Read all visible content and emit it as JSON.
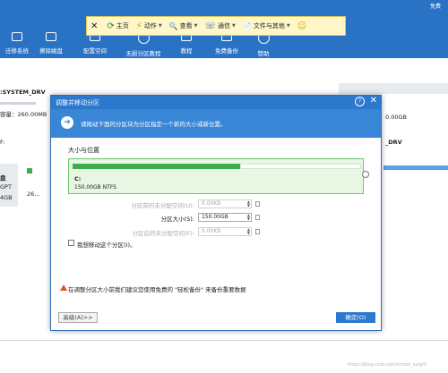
{
  "app": {
    "title": "免费"
  },
  "toolbar": {
    "items": [
      {
        "icon": "close-icon",
        "glyph": "✕",
        "label": ""
      },
      {
        "icon": "home-icon",
        "glyph": "⟳",
        "label": "主页"
      },
      {
        "icon": "lightning-icon",
        "glyph": "⚡",
        "label": "动作"
      },
      {
        "icon": "magnifier-icon",
        "glyph": "🔍",
        "label": "查看"
      },
      {
        "icon": "phone-icon",
        "glyph": "☏",
        "label": "通信"
      },
      {
        "icon": "file-icon",
        "glyph": "📄",
        "label": "文件与其他"
      },
      {
        "icon": "smiley-icon",
        "glyph": "☺",
        "label": ""
      }
    ]
  },
  "nav": {
    "items": [
      {
        "label": "迁移系统"
      },
      {
        "label": "擦除磁盘"
      },
      {
        "label": "配置空间"
      },
      {
        "label": "无损分区教程"
      },
      {
        "label": "教程"
      },
      {
        "label": "免费备份"
      },
      {
        "label": "赞助"
      }
    ]
  },
  "disk": {
    "name": ":SYSTEM_DRV",
    "capacity": "容量：260.00MB",
    "colon_label": "F:",
    "type_prefix": "盘",
    "gpt": "GPT",
    "size": "4GB",
    "small_num": "26...",
    "right_label": "_DRV",
    "right_size": "0.00GB"
  },
  "dialog": {
    "title": "调整并移动分区",
    "help": "?",
    "close": "✕",
    "banner_text": "请拖动下面的分区块为分区指定一个新的大小或新位置。",
    "banner_glyph": "➔",
    "size_position_label": "大小与位置",
    "partition_letter": "C:",
    "partition_info": "150.00GB NTFS",
    "partition_used_fraction": 0.58,
    "fields": [
      {
        "label": "分区前的未分配空间(U):",
        "value": "0.00KB",
        "enabled": false
      },
      {
        "label": "分区大小(S):",
        "value": "150.00GB",
        "enabled": true
      },
      {
        "label": "分区后的未分配空间(F):",
        "value": "0.00KB",
        "enabled": false
      }
    ],
    "checkbox_label": "我想移动这个分区(I)。",
    "checkbox_checked": false,
    "warning_text": "在调整分区大小前我们建议您使用免费的 \"轻松备份\" 来备份重要数据",
    "back_button": "高级(A)>>",
    "ok_button": "确定(O)"
  },
  "watermark": "https://blog.csdn.net/mrroot_seight"
}
